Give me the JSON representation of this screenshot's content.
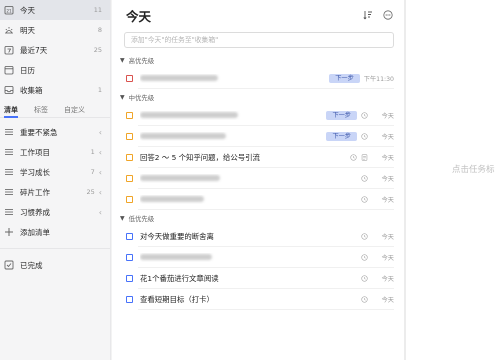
{
  "sidebar": {
    "smart_lists": [
      {
        "label": "今天",
        "count": "11",
        "icon": "calendar-day-icon"
      },
      {
        "label": "明天",
        "count": "8",
        "icon": "sunrise-icon"
      },
      {
        "label": "最近7天",
        "count": "25",
        "icon": "calendar-week-icon"
      },
      {
        "label": "日历",
        "count": "",
        "icon": "calendar-icon"
      },
      {
        "label": "收集箱",
        "count": "1",
        "icon": "inbox-icon"
      }
    ],
    "tabs": [
      "清单",
      "标签",
      "自定义"
    ],
    "lists": [
      {
        "label": "重要不紧急",
        "count": "",
        "icon": "list-icon"
      },
      {
        "label": "工作项目",
        "count": "1",
        "icon": "list-icon"
      },
      {
        "label": "学习成长",
        "count": "7",
        "icon": "list-icon"
      },
      {
        "label": "碎片工作",
        "count": "25",
        "icon": "list-icon"
      },
      {
        "label": "习惯养成",
        "count": "",
        "icon": "list-icon"
      }
    ],
    "add_list_label": "添加清单",
    "completed_label": "已完成"
  },
  "main": {
    "title": "今天",
    "add_placeholder": "添加\"今天\"的任务至\"收集箱\"",
    "sections": [
      {
        "name": "高优先级",
        "tasks": [
          {
            "title": "",
            "blurred_width": 78,
            "badge": "下一步",
            "date": "下午11:30",
            "priority": "high",
            "meta": ""
          }
        ]
      },
      {
        "name": "中优先级",
        "tasks": [
          {
            "title": "",
            "blurred_width": 98,
            "badge": "下一步",
            "date": "今天",
            "priority": "mid",
            "meta": "clock"
          },
          {
            "title": "",
            "blurred_width": 86,
            "badge": "下一步",
            "date": "今天",
            "priority": "mid",
            "meta": "clock"
          },
          {
            "title": "回答2 ～ 5 个知乎问题，给公号引流",
            "blurred_width": 0,
            "badge": "",
            "date": "今天",
            "priority": "mid",
            "meta": "clock-doc"
          },
          {
            "title": "",
            "blurred_width": 80,
            "badge": "",
            "date": "今天",
            "priority": "mid",
            "meta": "clock"
          },
          {
            "title": "",
            "blurred_width": 64,
            "badge": "",
            "date": "今天",
            "priority": "mid",
            "meta": "clock"
          }
        ]
      },
      {
        "name": "低优先级",
        "tasks": [
          {
            "title": "对今天做重要的断舍离",
            "blurred_width": 0,
            "badge": "",
            "date": "今天",
            "priority": "low",
            "meta": "clock"
          },
          {
            "title": "",
            "blurred_width": 72,
            "badge": "",
            "date": "今天",
            "priority": "low",
            "meta": "clock"
          },
          {
            "title": "花1个番茄进行文章阅读",
            "blurred_width": 0,
            "badge": "",
            "date": "今天",
            "priority": "low",
            "meta": "clock"
          },
          {
            "title": "查看短期目标（打卡）",
            "blurred_width": 0,
            "badge": "",
            "date": "今天",
            "priority": "low",
            "meta": "clock"
          }
        ]
      }
    ]
  },
  "detail": {
    "hint": "点击任务标"
  },
  "colors": {
    "accent": "#4772fa",
    "high": "#d9534f",
    "mid": "#f0a528",
    "low": "#4772fa",
    "badge_bg": "#c9d5f7"
  }
}
